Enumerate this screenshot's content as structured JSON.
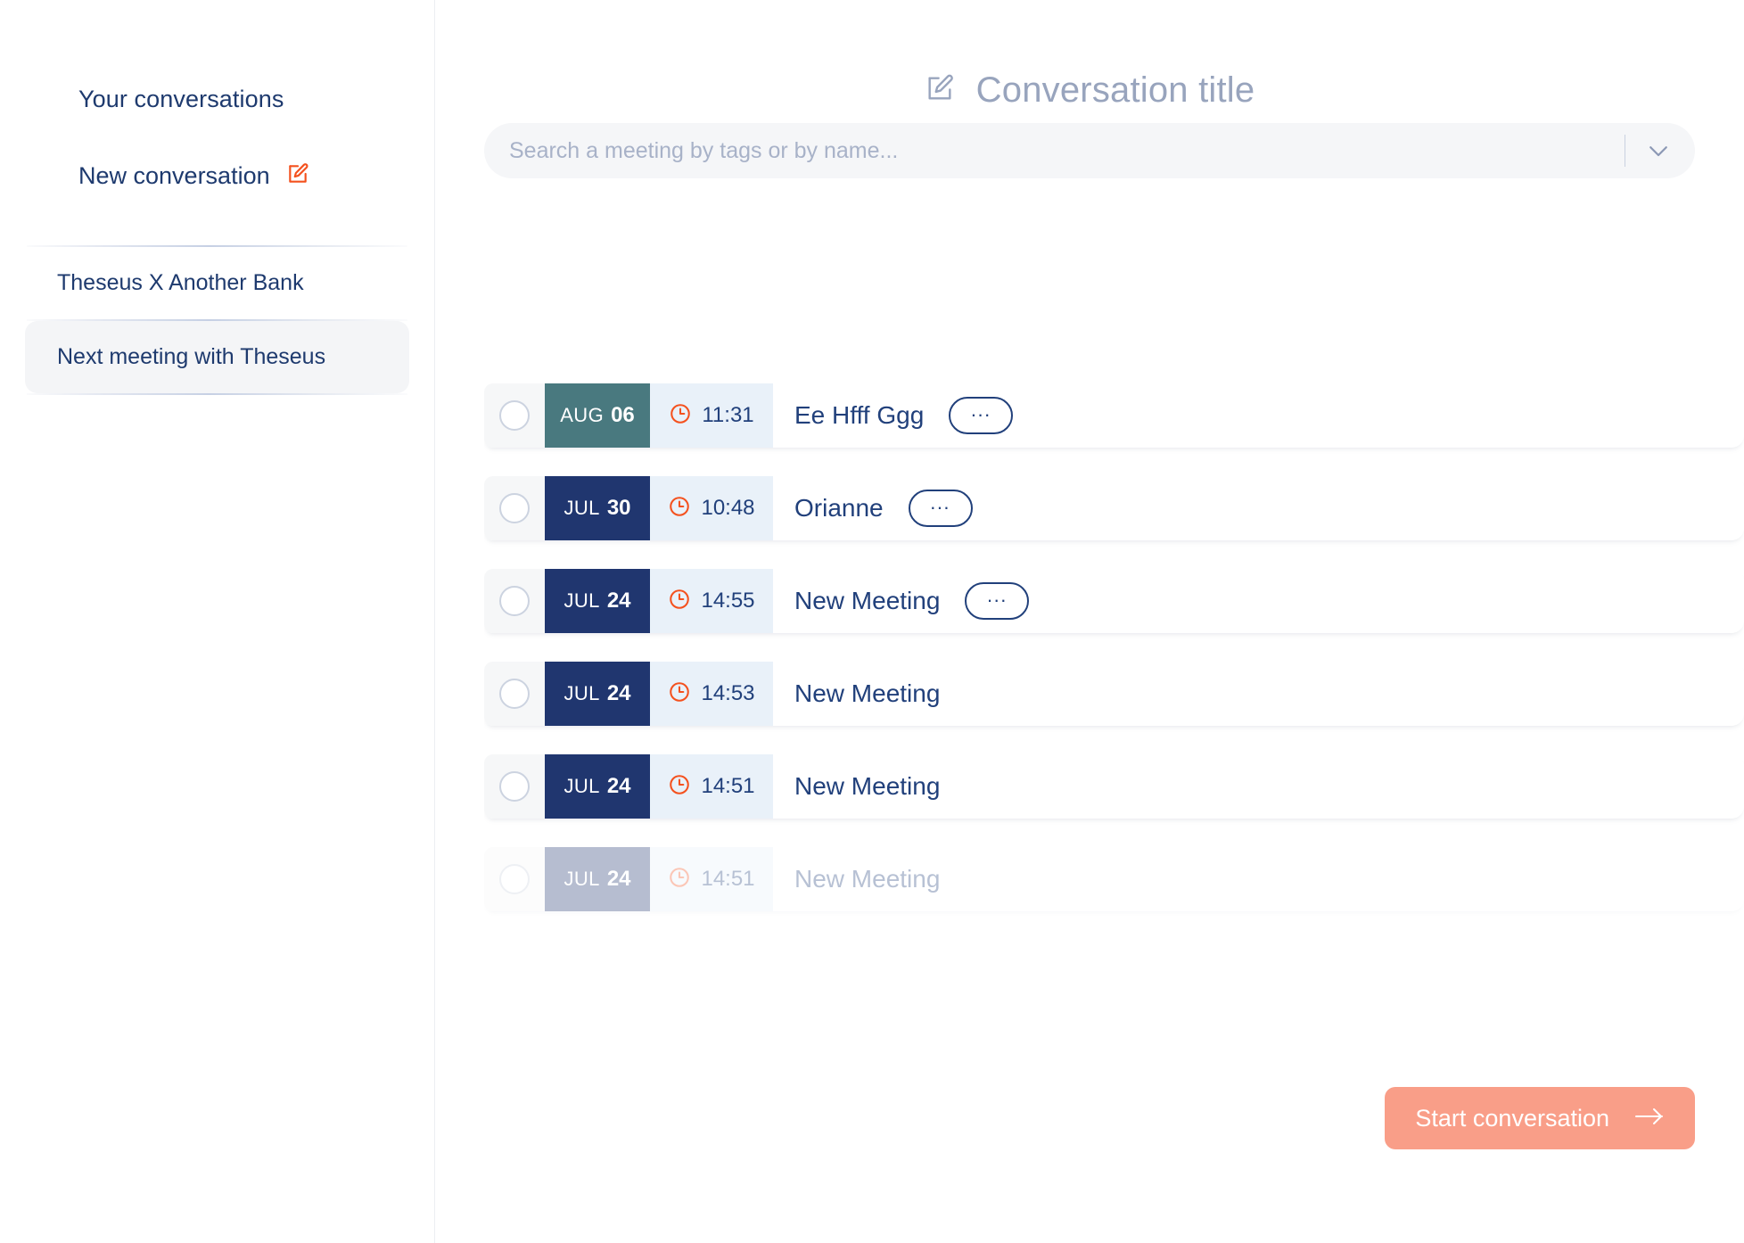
{
  "sidebar": {
    "title": "Your conversations",
    "new_conversation_label": "New conversation",
    "new_conversation_icon": "edit-pencil-icon",
    "conversations": [
      {
        "label": "Theseus X Another Bank",
        "selected": false
      },
      {
        "label": "Next meeting with Theseus",
        "selected": true
      }
    ]
  },
  "header": {
    "icon": "edit-pencil-icon",
    "title": "Conversation title"
  },
  "search": {
    "value": "",
    "placeholder": "Search a meeting by tags or by name...",
    "dropdown_icon": "chevron-down-icon"
  },
  "meetings": {
    "clock_icon": "clock-icon",
    "more_label": "...",
    "rows": [
      {
        "month": "AUG",
        "day": "06",
        "time": "11:31",
        "name": "Ee Hfff Ggg",
        "badge_color": "#49797f",
        "has_more": true,
        "faded": false,
        "checked": false
      },
      {
        "month": "JUL",
        "day": "30",
        "time": "10:48",
        "name": "Orianne",
        "badge_color": "#20366f",
        "has_more": true,
        "faded": false,
        "checked": false
      },
      {
        "month": "JUL",
        "day": "24",
        "time": "14:55",
        "name": "New Meeting",
        "badge_color": "#20366f",
        "has_more": true,
        "faded": false,
        "checked": false
      },
      {
        "month": "JUL",
        "day": "24",
        "time": "14:53",
        "name": "New Meeting",
        "badge_color": "#20366f",
        "has_more": false,
        "faded": false,
        "checked": false
      },
      {
        "month": "JUL",
        "day": "24",
        "time": "14:51",
        "name": "New Meeting",
        "badge_color": "#20366f",
        "has_more": false,
        "faded": false,
        "checked": false
      },
      {
        "month": "JUL",
        "day": "24",
        "time": "14:51",
        "name": "New Meeting",
        "badge_color": "#20366f",
        "has_more": false,
        "faded": true,
        "checked": false
      }
    ]
  },
  "footer": {
    "start_label": "Start conversation",
    "arrow_icon": "arrow-right-icon"
  },
  "colors": {
    "navy": "#20366f",
    "teal": "#49797f",
    "coral": "#f99e88",
    "orange": "#f4511e",
    "time_bg": "#e9f1f9",
    "muted": "#98a4bd"
  }
}
